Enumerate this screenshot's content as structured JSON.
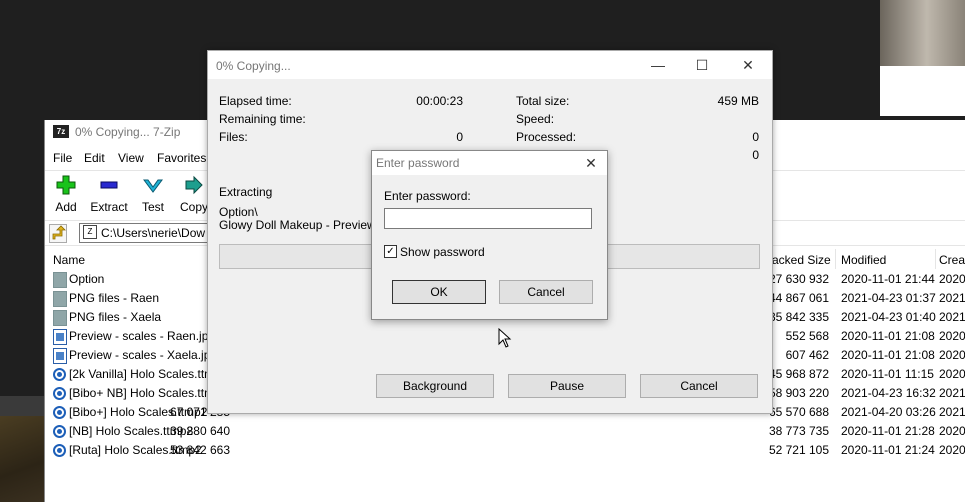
{
  "zip_window": {
    "title": "0% Copying... 7-Zip",
    "menu": [
      "File",
      "Edit",
      "View",
      "Favorites"
    ],
    "toolbar": [
      "Add",
      "Extract",
      "Test",
      "Copy"
    ],
    "address": "C:\\Users\\nerie\\Dow",
    "columns": {
      "name": "Name",
      "packed": "Packed Size",
      "modified": "Modified",
      "created": "Crea"
    },
    "rows": [
      {
        "name": "Option",
        "type": "folder",
        "size": "",
        "packed": "127 630 932",
        "modified": "2020-11-01 21:44",
        "created": "2020"
      },
      {
        "name": "PNG files - Raen",
        "type": "folder",
        "size": "",
        "packed": "44 867 061",
        "modified": "2021-04-23 01:37",
        "created": "2021"
      },
      {
        "name": "PNG files - Xaela",
        "type": "folder",
        "size": "",
        "packed": "35 842 335",
        "modified": "2021-04-23 01:40",
        "created": "2021"
      },
      {
        "name": "Preview - scales - Raen.jpg",
        "type": "image",
        "size": "",
        "packed": "552 568",
        "modified": "2020-11-01 21:08",
        "created": "2020"
      },
      {
        "name": "Preview - scales - Xaela.jpg",
        "type": "image",
        "size": "",
        "packed": "607 462",
        "modified": "2020-11-01 21:08",
        "created": "2020"
      },
      {
        "name": "[2k Vanilla] Holo Scales.ttmp2",
        "type": "ttmp",
        "size": "",
        "packed": "45 968 872",
        "modified": "2020-11-01 11:15",
        "created": "2020"
      },
      {
        "name": "[Bibo+ NB] Holo Scales.ttmp2",
        "type": "ttmp",
        "size": "",
        "packed": "58 903 220",
        "modified": "2021-04-23 16:32",
        "created": "2021"
      },
      {
        "name": "[Bibo+] Holo Scales.ttmp2",
        "type": "ttmp",
        "size": "67 071 285",
        "packed": "65 570 688",
        "modified": "2021-04-20 03:26",
        "created": "2021"
      },
      {
        "name": "[NB] Holo Scales.ttmp2",
        "type": "ttmp",
        "size": "39 880 640",
        "packed": "38 773 735",
        "modified": "2020-11-01 21:28",
        "created": "2020"
      },
      {
        "name": "[Ruta] Holo Scales.ttmp2",
        "type": "ttmp",
        "size": "53 842 663",
        "packed": "52 721 105",
        "modified": "2020-11-01 21:24",
        "created": "2020"
      }
    ]
  },
  "progress_dialog": {
    "title": "0% Copying...",
    "elapsed_label": "Elapsed time:",
    "elapsed_value": "00:00:23",
    "remaining_label": "Remaining time:",
    "files_label": "Files:",
    "files_value": "0",
    "total_size_label": "Total size:",
    "total_size_value": "459 MB",
    "speed_label": "Speed:",
    "processed_label": "Processed:",
    "processed_value": "0",
    "extra_value": "0",
    "action": "Extracting",
    "path_line1": "Option\\",
    "path_line2": "Glowy Doll Makeup - Preview.UP",
    "progress_percent": 0,
    "buttons": {
      "background": "Background",
      "pause": "Pause",
      "cancel": "Cancel"
    }
  },
  "password_dialog": {
    "title": "Enter password",
    "prompt": "Enter password:",
    "value": "",
    "show_password_label": "Show password",
    "show_password_checked": true,
    "ok": "OK",
    "cancel": "Cancel"
  },
  "icons": {
    "close": "✕",
    "minimize": "—",
    "maximize": "☐",
    "check": "✓"
  }
}
